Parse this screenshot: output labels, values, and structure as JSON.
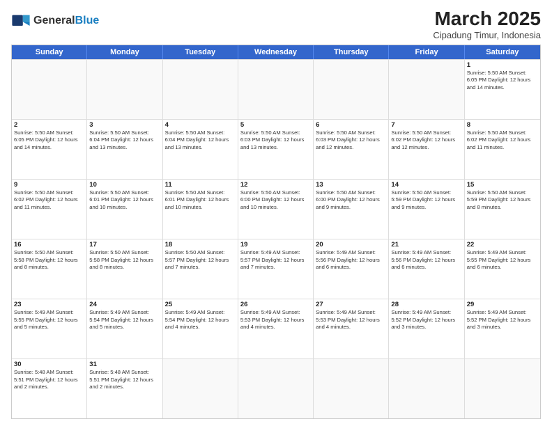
{
  "logo": {
    "general": "General",
    "blue": "Blue"
  },
  "title": "March 2025",
  "subtitle": "Cipadung Timur, Indonesia",
  "header_days": [
    "Sunday",
    "Monday",
    "Tuesday",
    "Wednesday",
    "Thursday",
    "Friday",
    "Saturday"
  ],
  "weeks": [
    [
      {
        "day": "",
        "info": ""
      },
      {
        "day": "",
        "info": ""
      },
      {
        "day": "",
        "info": ""
      },
      {
        "day": "",
        "info": ""
      },
      {
        "day": "",
        "info": ""
      },
      {
        "day": "",
        "info": ""
      },
      {
        "day": "1",
        "info": "Sunrise: 5:50 AM\nSunset: 6:05 PM\nDaylight: 12 hours and 14 minutes."
      }
    ],
    [
      {
        "day": "2",
        "info": "Sunrise: 5:50 AM\nSunset: 6:05 PM\nDaylight: 12 hours and 14 minutes."
      },
      {
        "day": "3",
        "info": "Sunrise: 5:50 AM\nSunset: 6:04 PM\nDaylight: 12 hours and 13 minutes."
      },
      {
        "day": "4",
        "info": "Sunrise: 5:50 AM\nSunset: 6:04 PM\nDaylight: 12 hours and 13 minutes."
      },
      {
        "day": "5",
        "info": "Sunrise: 5:50 AM\nSunset: 6:03 PM\nDaylight: 12 hours and 13 minutes."
      },
      {
        "day": "6",
        "info": "Sunrise: 5:50 AM\nSunset: 6:03 PM\nDaylight: 12 hours and 12 minutes."
      },
      {
        "day": "7",
        "info": "Sunrise: 5:50 AM\nSunset: 6:02 PM\nDaylight: 12 hours and 12 minutes."
      },
      {
        "day": "8",
        "info": "Sunrise: 5:50 AM\nSunset: 6:02 PM\nDaylight: 12 hours and 11 minutes."
      }
    ],
    [
      {
        "day": "9",
        "info": "Sunrise: 5:50 AM\nSunset: 6:02 PM\nDaylight: 12 hours and 11 minutes."
      },
      {
        "day": "10",
        "info": "Sunrise: 5:50 AM\nSunset: 6:01 PM\nDaylight: 12 hours and 10 minutes."
      },
      {
        "day": "11",
        "info": "Sunrise: 5:50 AM\nSunset: 6:01 PM\nDaylight: 12 hours and 10 minutes."
      },
      {
        "day": "12",
        "info": "Sunrise: 5:50 AM\nSunset: 6:00 PM\nDaylight: 12 hours and 10 minutes."
      },
      {
        "day": "13",
        "info": "Sunrise: 5:50 AM\nSunset: 6:00 PM\nDaylight: 12 hours and 9 minutes."
      },
      {
        "day": "14",
        "info": "Sunrise: 5:50 AM\nSunset: 5:59 PM\nDaylight: 12 hours and 9 minutes."
      },
      {
        "day": "15",
        "info": "Sunrise: 5:50 AM\nSunset: 5:59 PM\nDaylight: 12 hours and 8 minutes."
      }
    ],
    [
      {
        "day": "16",
        "info": "Sunrise: 5:50 AM\nSunset: 5:58 PM\nDaylight: 12 hours and 8 minutes."
      },
      {
        "day": "17",
        "info": "Sunrise: 5:50 AM\nSunset: 5:58 PM\nDaylight: 12 hours and 8 minutes."
      },
      {
        "day": "18",
        "info": "Sunrise: 5:50 AM\nSunset: 5:57 PM\nDaylight: 12 hours and 7 minutes."
      },
      {
        "day": "19",
        "info": "Sunrise: 5:49 AM\nSunset: 5:57 PM\nDaylight: 12 hours and 7 minutes."
      },
      {
        "day": "20",
        "info": "Sunrise: 5:49 AM\nSunset: 5:56 PM\nDaylight: 12 hours and 6 minutes."
      },
      {
        "day": "21",
        "info": "Sunrise: 5:49 AM\nSunset: 5:56 PM\nDaylight: 12 hours and 6 minutes."
      },
      {
        "day": "22",
        "info": "Sunrise: 5:49 AM\nSunset: 5:55 PM\nDaylight: 12 hours and 6 minutes."
      }
    ],
    [
      {
        "day": "23",
        "info": "Sunrise: 5:49 AM\nSunset: 5:55 PM\nDaylight: 12 hours and 5 minutes."
      },
      {
        "day": "24",
        "info": "Sunrise: 5:49 AM\nSunset: 5:54 PM\nDaylight: 12 hours and 5 minutes."
      },
      {
        "day": "25",
        "info": "Sunrise: 5:49 AM\nSunset: 5:54 PM\nDaylight: 12 hours and 4 minutes."
      },
      {
        "day": "26",
        "info": "Sunrise: 5:49 AM\nSunset: 5:53 PM\nDaylight: 12 hours and 4 minutes."
      },
      {
        "day": "27",
        "info": "Sunrise: 5:49 AM\nSunset: 5:53 PM\nDaylight: 12 hours and 4 minutes."
      },
      {
        "day": "28",
        "info": "Sunrise: 5:49 AM\nSunset: 5:52 PM\nDaylight: 12 hours and 3 minutes."
      },
      {
        "day": "29",
        "info": "Sunrise: 5:49 AM\nSunset: 5:52 PM\nDaylight: 12 hours and 3 minutes."
      }
    ],
    [
      {
        "day": "30",
        "info": "Sunrise: 5:48 AM\nSunset: 5:51 PM\nDaylight: 12 hours and 2 minutes."
      },
      {
        "day": "31",
        "info": "Sunrise: 5:48 AM\nSunset: 5:51 PM\nDaylight: 12 hours and 2 minutes."
      },
      {
        "day": "",
        "info": ""
      },
      {
        "day": "",
        "info": ""
      },
      {
        "day": "",
        "info": ""
      },
      {
        "day": "",
        "info": ""
      },
      {
        "day": "",
        "info": ""
      }
    ]
  ]
}
